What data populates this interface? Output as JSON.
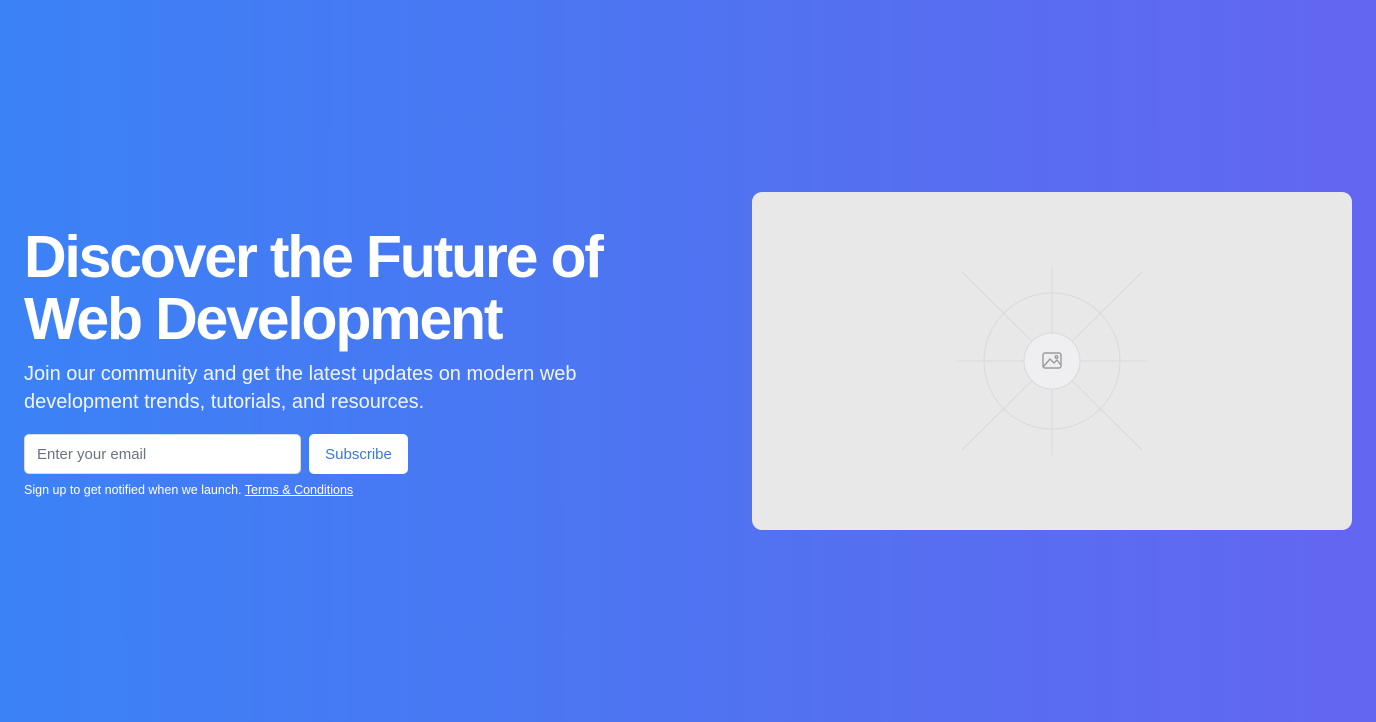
{
  "hero": {
    "headline_line1": "Discover the Future of",
    "headline_line2": "Web Development",
    "subheadline": "Join our community and get the latest updates on modern web development trends, tutorials, and resources."
  },
  "signup": {
    "email_placeholder": "Enter your email",
    "email_value": "",
    "subscribe_label": "Subscribe",
    "fine_print": "Sign up to get notified when we launch.",
    "terms_label": "Terms & Conditions"
  },
  "media": {
    "icon": "image-placeholder-icon"
  },
  "colors": {
    "gradient_start": "#3b82f6",
    "gradient_end": "#6366f1",
    "button_text": "#3b7ad9",
    "placeholder_bg": "#e9e8e9"
  }
}
